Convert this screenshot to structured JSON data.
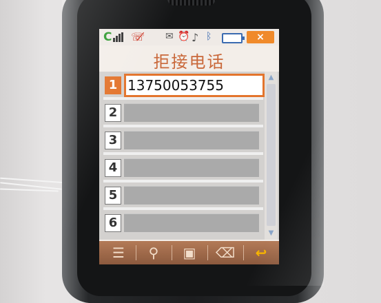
{
  "status": {
    "signal_letter": "C",
    "icons": [
      "no-call-icon",
      "message-icon",
      "alarm-icon",
      "music-note-icon",
      "bluetooth-icon",
      "battery-icon"
    ],
    "close_label": "×"
  },
  "title": "拒接电话",
  "rows": [
    {
      "num": "1",
      "value": "13750053755"
    },
    {
      "num": "2",
      "value": ""
    },
    {
      "num": "3",
      "value": ""
    },
    {
      "num": "4",
      "value": ""
    },
    {
      "num": "5",
      "value": ""
    },
    {
      "num": "6",
      "value": ""
    }
  ],
  "softkeys": [
    "list-icon",
    "search-icon",
    "save-icon",
    "erase-icon",
    "back-icon"
  ],
  "colors": {
    "accent": "#e3742c",
    "title": "#c9683a",
    "softbar": "#a06a4a"
  }
}
